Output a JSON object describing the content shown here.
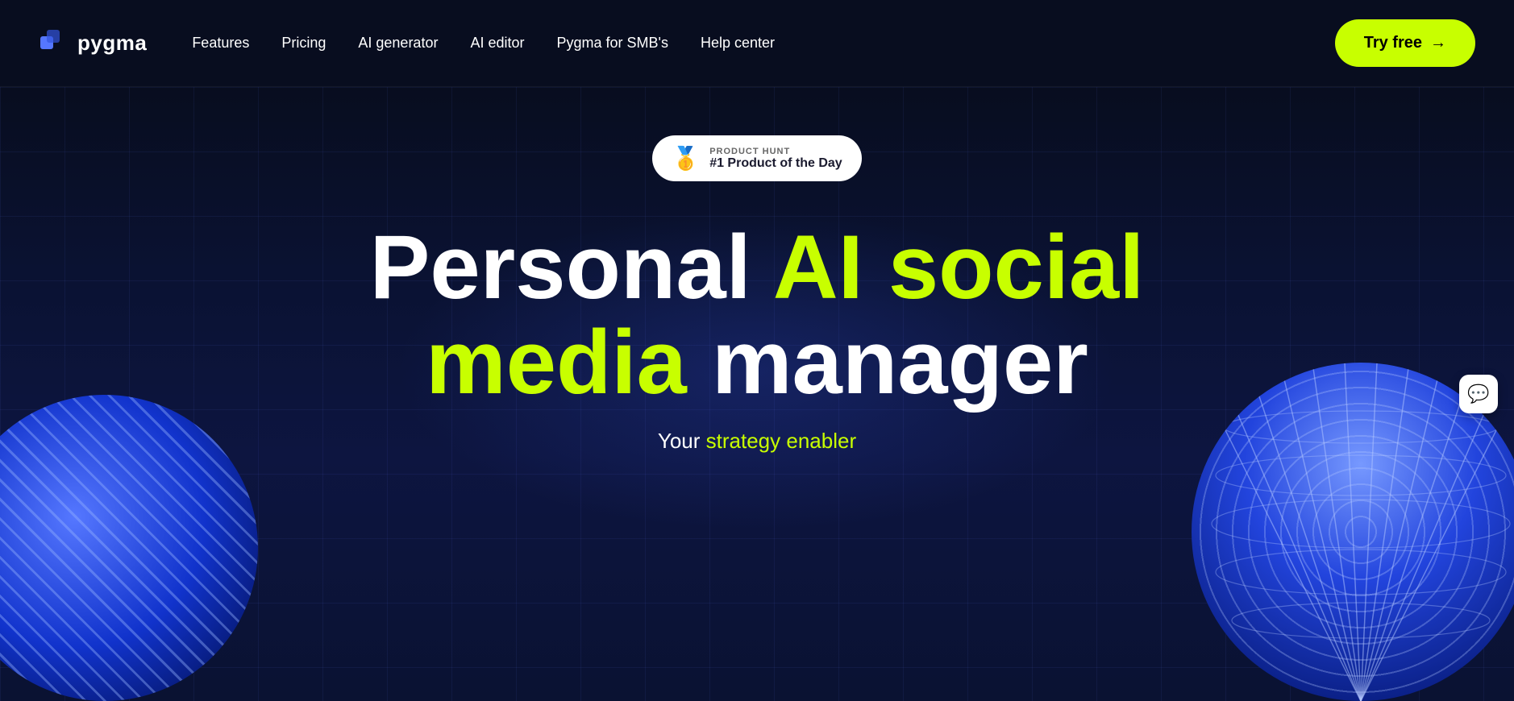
{
  "logo": {
    "text": "pygma"
  },
  "nav": {
    "links": [
      {
        "id": "features",
        "label": "Features"
      },
      {
        "id": "pricing",
        "label": "Pricing"
      },
      {
        "id": "ai-generator",
        "label": "AI generator"
      },
      {
        "id": "ai-editor",
        "label": "AI editor"
      },
      {
        "id": "smb",
        "label": "Pygma for SMB's"
      },
      {
        "id": "help",
        "label": "Help center"
      }
    ],
    "cta": {
      "label": "Try free",
      "arrow": "→"
    }
  },
  "hero": {
    "badge": {
      "label_top": "PRODUCT HUNT",
      "label_bottom": "#1 Product of the Day",
      "medal": "🥇"
    },
    "headline": {
      "line1_part1": "Personal ",
      "line1_part2": "AI social",
      "line2_part1": "media",
      "line2_part2": " manager"
    },
    "subtitle": {
      "part1": "Your ",
      "part2": "strategy enabler"
    }
  },
  "chat": {
    "icon": "💬"
  }
}
